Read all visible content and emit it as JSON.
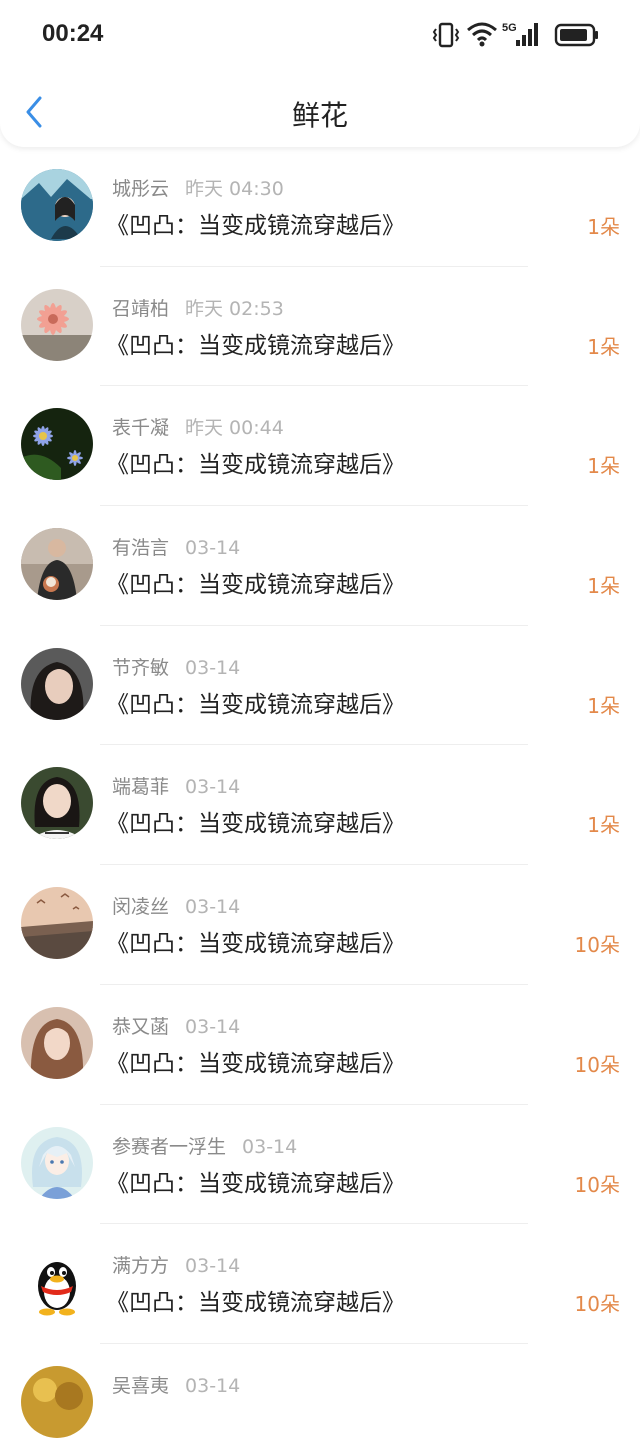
{
  "status_bar": {
    "time": "00:24",
    "network": "5G",
    "icons": [
      "vibrate-icon",
      "wifi-icon",
      "signal-icon",
      "battery-icon"
    ]
  },
  "nav": {
    "back_icon": "chevron-left-icon",
    "title": "鲜花"
  },
  "colors": {
    "accent_blue": "#3a8ee6",
    "count_orange": "#e3894a",
    "name_gray": "#8a8a8a",
    "time_gray": "#b4b4b4"
  },
  "items": [
    {
      "name": "城彤云",
      "time": "昨天 04:30",
      "book": "《凹凸：当变成镜流穿越后》",
      "count": "1朵"
    },
    {
      "name": "召靖柏",
      "time": "昨天 02:53",
      "book": "《凹凸：当变成镜流穿越后》",
      "count": "1朵"
    },
    {
      "name": "表千凝",
      "time": "昨天 00:44",
      "book": "《凹凸：当变成镜流穿越后》",
      "count": "1朵"
    },
    {
      "name": "有浩言",
      "time": "03-14",
      "book": "《凹凸：当变成镜流穿越后》",
      "count": "1朵"
    },
    {
      "name": "节齐敏",
      "time": "03-14",
      "book": "《凹凸：当变成镜流穿越后》",
      "count": "1朵"
    },
    {
      "name": "端葛菲",
      "time": "03-14",
      "book": "《凹凸：当变成镜流穿越后》",
      "count": "1朵"
    },
    {
      "name": "闵凌丝",
      "time": "03-14",
      "book": "《凹凸：当变成镜流穿越后》",
      "count": "10朵"
    },
    {
      "name": "恭又菡",
      "time": "03-14",
      "book": "《凹凸：当变成镜流穿越后》",
      "count": "10朵"
    },
    {
      "name": "参赛者一浮生",
      "time": "03-14",
      "book": "《凹凸：当变成镜流穿越后》",
      "count": "10朵"
    },
    {
      "name": "满方方",
      "time": "03-14",
      "book": "《凹凸：当变成镜流穿越后》",
      "count": "10朵"
    },
    {
      "name": "吴喜夷",
      "time": "03-14"
    }
  ]
}
